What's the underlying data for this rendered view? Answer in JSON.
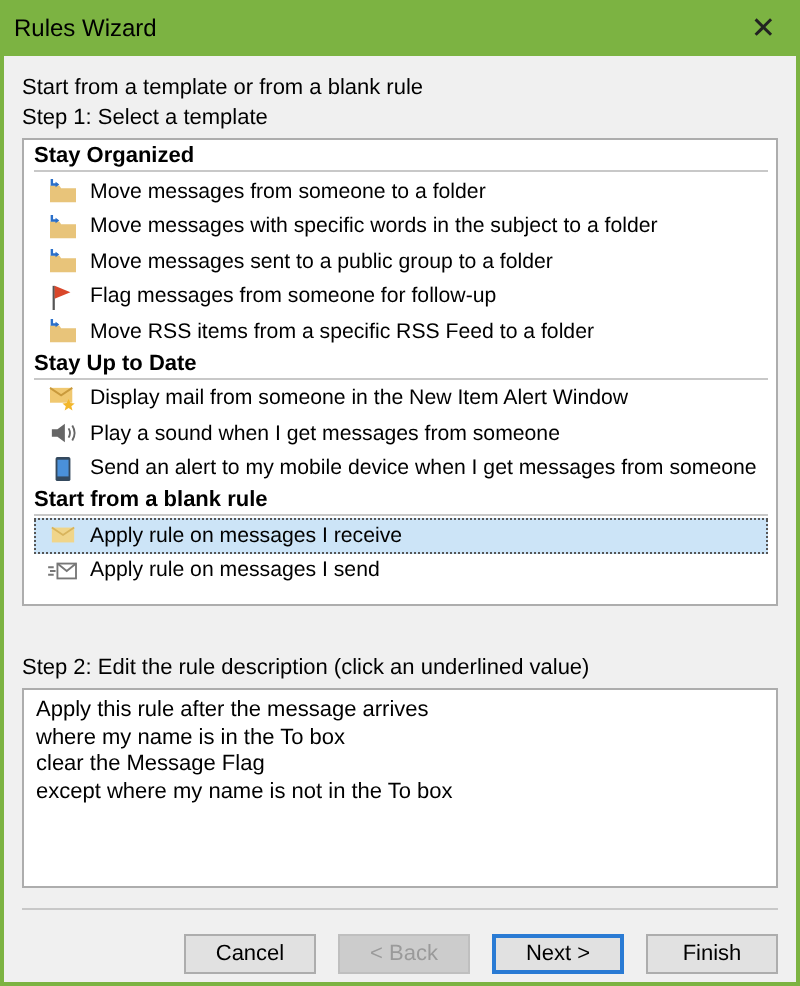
{
  "window": {
    "title": "Rules Wizard",
    "close": "✕"
  },
  "intro": "Start from a template or from a blank rule",
  "step1": "Step 1: Select a template",
  "groups": [
    {
      "title": "Stay Organized",
      "items": [
        {
          "label": "Move messages from someone to a folder",
          "kind": "folder",
          "selected": false
        },
        {
          "label": "Move messages with specific words in the subject to a folder",
          "kind": "folder",
          "selected": false
        },
        {
          "label": "Move messages sent to a public group to a folder",
          "kind": "folder",
          "selected": false
        },
        {
          "label": "Flag messages from someone for follow-up",
          "kind": "flag",
          "selected": false
        },
        {
          "label": "Move RSS items from a specific RSS Feed to a folder",
          "kind": "folder",
          "selected": false
        }
      ]
    },
    {
      "title": "Stay Up to Date",
      "items": [
        {
          "label": "Display mail from someone in the New Item Alert Window",
          "kind": "alert",
          "selected": false
        },
        {
          "label": "Play a sound when I get messages from someone",
          "kind": "sound",
          "selected": false
        },
        {
          "label": "Send an alert to my mobile device when I get messages from someone",
          "kind": "phone",
          "selected": false
        }
      ]
    },
    {
      "title": "Start from a blank rule",
      "items": [
        {
          "label": "Apply rule on messages I receive",
          "kind": "receive",
          "selected": true
        },
        {
          "label": "Apply rule on messages I send",
          "kind": "send",
          "selected": false
        }
      ]
    }
  ],
  "step2": "Step 2: Edit the rule description (click an underlined value)",
  "description": [
    "Apply this rule after the message arrives",
    "where my name is in the To box",
    "clear the Message Flag",
    "except where my name is not in the To box"
  ],
  "buttons": [
    {
      "label": "Cancel",
      "disabled": false,
      "default": false
    },
    {
      "label": "< Back",
      "disabled": true,
      "default": false
    },
    {
      "label": "Next >",
      "disabled": false,
      "default": true
    },
    {
      "label": "Finish",
      "disabled": false,
      "default": false
    }
  ]
}
